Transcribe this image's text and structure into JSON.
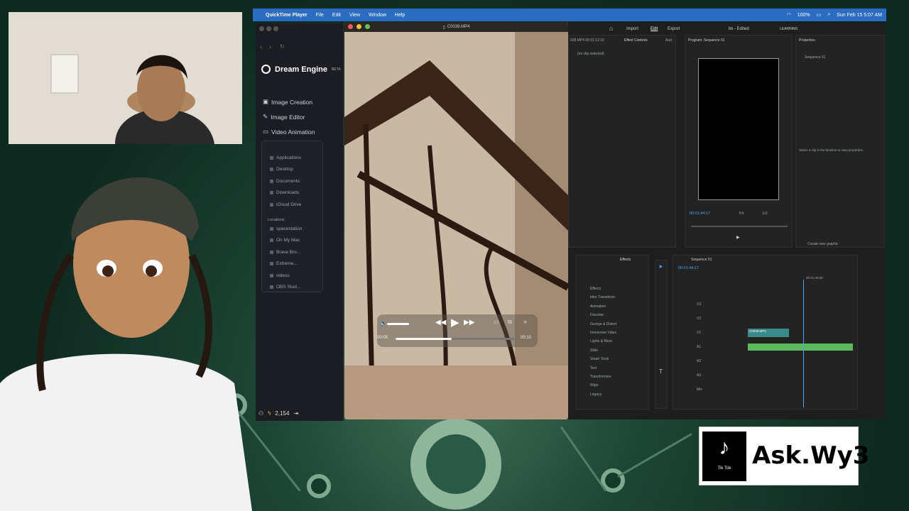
{
  "menubar": {
    "app": "QuickTime Player",
    "items": [
      "File",
      "Edit",
      "View",
      "Window",
      "Help"
    ],
    "battery": "100%",
    "datetime": "Sun Feb 15  5:07 AM"
  },
  "dream": {
    "title": "Dream Engine",
    "beta": "BETA",
    "nav": [
      "Image Creation",
      "Image Editor",
      "Video Animation"
    ],
    "credits": "2,154"
  },
  "finder": {
    "favorites": [
      "Applications",
      "Desktop",
      "Documents",
      "Downloads",
      "iCloud Drive"
    ],
    "locations_header": "Locations",
    "locations": [
      "spacestation",
      "On My Mac",
      "Brave Bro...",
      "Extreme...",
      "videos",
      "OBS Stud..."
    ]
  },
  "quicktime": {
    "filename": "C0039.MP4",
    "elapsed": "00:05",
    "remaining": "00:10",
    "progress": 0.47,
    "volume": 0.85
  },
  "premiere": {
    "tabs": [
      "Import",
      "Edit",
      "Export"
    ],
    "project": "bk - Edited",
    "workspace": "LEARNING",
    "panel_effect_controls": "Effect Controls",
    "audio_tab": "Aud",
    "no_clip": "(no clip selected)",
    "program_title": "Program: Sequence 01",
    "program_time": "00:01:44:17",
    "fit": "Fit",
    "quality": "1/2",
    "properties": "Properties",
    "seq_name": "Sequence 01",
    "select_clip_msg": "Select a clip in the timeline to view properties.",
    "create_graphic": "Create new graphic",
    "timecode_left": "028.MP4  00:01:12:16",
    "effects_tab": "Effects",
    "effects": [
      "Effects",
      "ideo Transitions",
      "Animation",
      "Dissolve",
      "Grunge & Distort",
      "Immersive Video",
      "Lights & Blurs",
      "Slide",
      "Smart Tools",
      "Text",
      "Transformers",
      "Wipe",
      "Legacy"
    ],
    "seq_tab": "Sequence 01",
    "seq_time": "00:01:44:17",
    "ruler_time": "00:01:45:00",
    "clip_label": "C0039.MP4",
    "tracks": [
      "V3",
      "V2",
      "V1",
      "A1",
      "A2",
      "A3",
      "Mix"
    ]
  },
  "tiktok": {
    "brand": "Tik Tok",
    "handle": "Ask.Wy3"
  },
  "colors": {
    "menubar": "#2a6cc2",
    "accent": "#2d8cf0",
    "clip": "#3a8a8a",
    "audio": "#5cb85c"
  }
}
